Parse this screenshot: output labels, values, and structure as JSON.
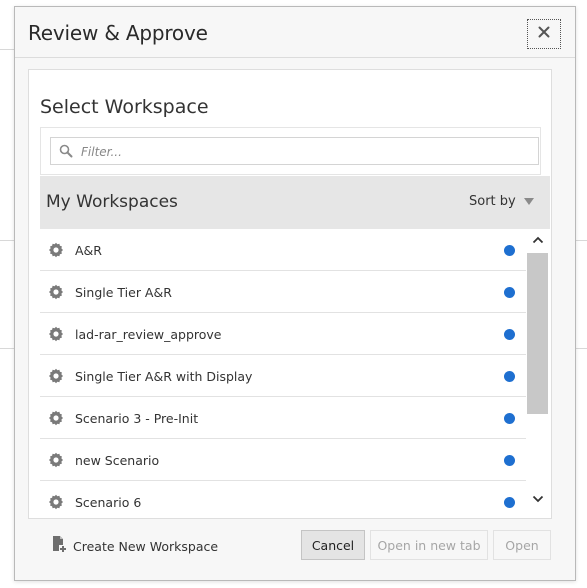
{
  "dialog": {
    "title": "Review & Approve",
    "close_label": "Close"
  },
  "panel": {
    "title": "Select Workspace"
  },
  "filter": {
    "placeholder": "Filter...",
    "value": ""
  },
  "list": {
    "header_title": "My Workspaces",
    "sort_label": "Sort by",
    "items": [
      {
        "name": "A&R",
        "status_color": "#1e6fd0"
      },
      {
        "name": "Single Tier A&R",
        "status_color": "#1e6fd0"
      },
      {
        "name": "lad-rar_review_approve",
        "status_color": "#1e6fd0"
      },
      {
        "name": "Single Tier A&R with Display",
        "status_color": "#1e6fd0"
      },
      {
        "name": "Scenario 3 - Pre-Init",
        "status_color": "#1e6fd0"
      },
      {
        "name": "new Scenario",
        "status_color": "#1e6fd0"
      },
      {
        "name": "Scenario 6",
        "status_color": "#1e6fd0"
      }
    ]
  },
  "footer": {
    "create_label": "Create New Workspace",
    "cancel_label": "Cancel",
    "open_new_tab_label": "Open in new tab",
    "open_label": "Open"
  },
  "icons": {
    "close": "close-icon",
    "search": "search-icon",
    "workspace": "gear-icon",
    "create": "document-add-icon",
    "scroll_up": "chevron-up-icon",
    "scroll_down": "chevron-down-icon",
    "sort": "caret-down-icon"
  },
  "colors": {
    "status_dot": "#1e6fd0",
    "header_bg": "#e6e6e6",
    "disabled_text": "#a6a6a6"
  }
}
